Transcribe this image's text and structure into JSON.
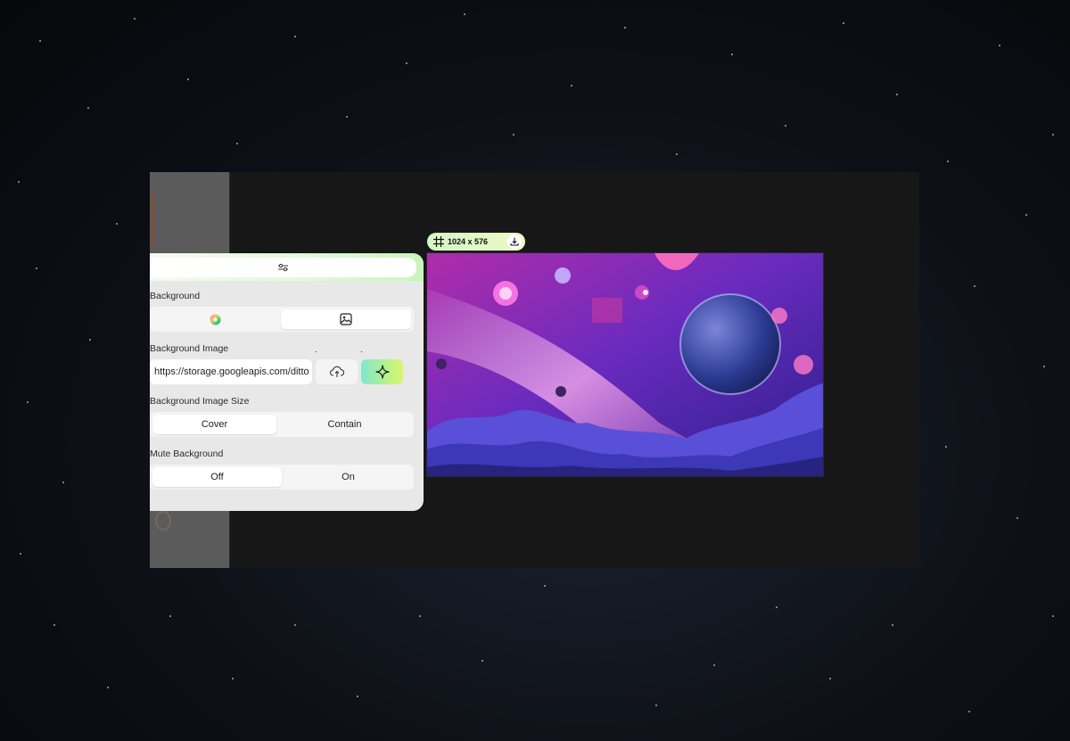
{
  "panel": {
    "background_label": "Background",
    "background_tabs": [
      {
        "icon": "color-wheel-icon",
        "active": false
      },
      {
        "icon": "image-icon",
        "active": true
      }
    ],
    "background_image_label": "Background Image",
    "image_url": "https://storage.googleapis.com/ditto",
    "upload_icon": "cloud-upload-icon",
    "generate_icon": "sparkle-icon",
    "image_size_label": "Background Image Size",
    "image_size_options": [
      "Cover",
      "Contain"
    ],
    "image_size_selected": "Cover",
    "mute_label": "Mute Background",
    "mute_options": [
      "Off",
      "On"
    ],
    "mute_selected": "Off",
    "header_icon": "sliders-icon"
  },
  "canvas": {
    "size_label": "1024 x 576",
    "download_icon": "download-icon",
    "frame_icon": "frame-icon"
  },
  "colors": {
    "accent_green": "#c8f5b8",
    "accent_gradient_start": "#7fe7d1",
    "accent_gradient_end": "#d8f56f",
    "workspace_bg": "#171717",
    "panel_bg": "#e8e8e8"
  }
}
